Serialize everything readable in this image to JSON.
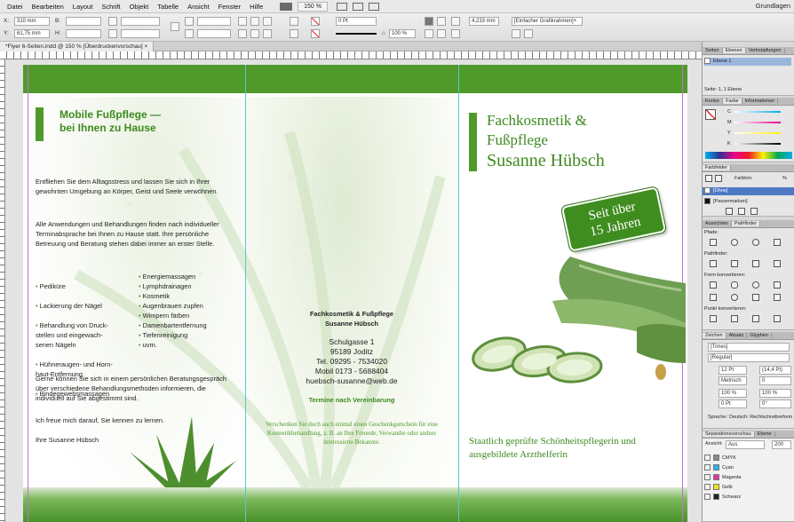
{
  "menubar": {
    "items": [
      "Datei",
      "Bearbeiten",
      "Layout",
      "Schrift",
      "Objekt",
      "Tabelle",
      "Ansicht",
      "Fenster",
      "Hilfe"
    ],
    "zoom": "150 %",
    "workspace": "Grundlagen"
  },
  "control": {
    "x_label": "X:",
    "x_value": "310 mm",
    "y_label": "Y:",
    "y_value": "61,75 mm",
    "b_label": "B:",
    "h_label": "H:",
    "stroke_value": "0 Pt",
    "size_value": "4,233 mm",
    "opacity_value": "100 %",
    "frame_style": "[Einfacher Grafikrahmen]+"
  },
  "document_tab": "*Flyer 6-Seiten.indd @ 150 % [Überdruckenvorschau]",
  "left_panel": {
    "heading": "Mobile Fußpflege —\nbei Ihnen zu Hause",
    "para1": "Entfliehen Sie dem Alltagsstress und lassen Sie sich in Ihrer gewohnten Umgebung an Körper, Geist und Seele verwöhnen.",
    "para2": "Alle Anwendungen und Behandlungen finden nach individueller Terminabsprache bei Ihnen zu Hause statt. Ihre persönliche Betreuung und Beratung stehen dabei immer an erster Stelle.",
    "list_left": [
      "Pediküre",
      "Lackierung der Nägel",
      "Behandlung von Druck-\nstellen und eingewach-\nsenen Nägeln",
      "Hühneraugen- und Horn-\nhaut-Entfernung",
      "Bindegewebsmassagen"
    ],
    "list_right": [
      "Energiemassagen",
      "Lymphdrainagen",
      "Kosmetik",
      "Augenbrauen zupfen",
      "Wimpern färben",
      "Damenbartentfernung",
      "Tiefenreinigung",
      "uvm."
    ],
    "para3": "Gerne können Sie sich in einem persönlichen Beratungsgespräch über verschiedene Behandlungsmethoden informieren, die individuell auf Sie abgestimmt sind.",
    "para4": "Ich freue mich darauf, Sie kennen zu lernen.",
    "sign": "Ihre Susanne Hübsch"
  },
  "middle_panel": {
    "title1": "Fachkosmetik & Fußpflege",
    "title2": "Susanne Hübsch",
    "street": "Schulgasse 1",
    "city": "95189 Joditz",
    "phone": "Tel. 09295 - 7534020",
    "mobile": "Mobil 0173 - 5688404",
    "email": "huebsch-susanne@web.de",
    "appointment": "Termine nach Vereinbarung",
    "voucher": "Verschenken Sie doch auch einmal einen Geschenkgutschein für eine Kosmetikbehandlung, z. B. an Ihre Freunde, Verwandte oder andere interessierte Bekannte."
  },
  "right_panel": {
    "title_line1": "Fachkosmetik &",
    "title_line2": "Fußpflege",
    "title_line3": "Susanne Hübsch",
    "badge_line1": "Seit über",
    "badge_line2": "15 Jahren",
    "footer": "Staatlich geprüfte Schönheitspflegerin und ausgebildete Arzthelferin"
  },
  "side_panels": {
    "layers_tabs": [
      "Seiten",
      "Ebenen",
      "Verknüpfungen"
    ],
    "layer_name": "Ebene 1",
    "layer_status": "Seite: 1, 1 Ebene",
    "color_tabs": [
      "Kontur",
      "Farbe",
      "Informationen"
    ],
    "color_channels": [
      "C",
      "M",
      "Y",
      "K"
    ],
    "swatches_tab": "Farbfelder",
    "tint_label": "Farbton:",
    "tint_unit": "%",
    "swatch_items": [
      "[Ohne]",
      "[Passermarken]"
    ],
    "align_tabs": [
      "Ausrichten",
      "Pathfinder"
    ],
    "pfade_label": "Pfade:",
    "pathfinder_label": "Pathfinder:",
    "form_label": "Form konvertieren:",
    "punkt_label": "Punkt konvertieren:",
    "char_tabs": [
      "Zeichen",
      "Absatz",
      "Glyphen"
    ],
    "font_name": "[Times]",
    "font_style": "[Regular]",
    "font_size": "12 Pt",
    "leading": "(14,4 Pt)",
    "kerning": "Metrisch",
    "tracking": "0",
    "scale_v": "100 %",
    "scale_h": "100 %",
    "baseline": "0 Pt",
    "skew": "0°",
    "language_label": "Sprache:",
    "language": "Deutsch: Rechtschreibreform",
    "sep_tabs": [
      "Separationsvorschau",
      "Ebene"
    ],
    "sep_view_label": "Ansicht:",
    "sep_view": "Aus",
    "sep_value": "200",
    "sep_items": [
      "CMYK",
      "Cyan",
      "Magenta",
      "Gelb",
      "Schwarz"
    ],
    "sep_colors": [
      "#888888",
      "#2bb3e6",
      "#e0379a",
      "#f4e11c",
      "#222222"
    ]
  }
}
